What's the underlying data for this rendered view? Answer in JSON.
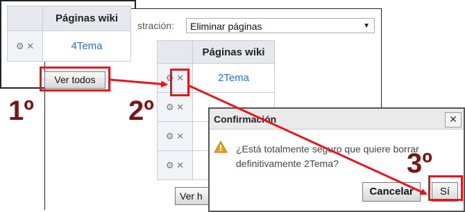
{
  "small_panel": {
    "header": "Páginas wiki",
    "row_link": "4Tema",
    "settings_glyph": "⚙",
    "delete_glyph": "✕",
    "button": "Ver todos"
  },
  "main_panel": {
    "admin_label": "stración:",
    "select_value": "Eliminar páginas",
    "header": "Páginas wiki",
    "rows": [
      {
        "link": "2Tema"
      },
      {
        "link": ""
      },
      {
        "link": ""
      },
      {
        "link": ""
      }
    ],
    "settings_glyph": "⚙",
    "delete_glyph": "✕",
    "button_partial": "Ver h"
  },
  "dialog": {
    "title": "Confirmación",
    "close_glyph": "✕",
    "message": "¿Está totalmente seguro que quiere borrar definitivamente 2Tema?",
    "cancel_label": "Cancelar",
    "confirm_label": "Sí"
  },
  "step_labels": {
    "first": "1º",
    "second": "2º",
    "third": "3º"
  },
  "colors": {
    "highlight": "#e8141c",
    "ordinal": "#7a1515",
    "link": "#2a6fd0"
  }
}
